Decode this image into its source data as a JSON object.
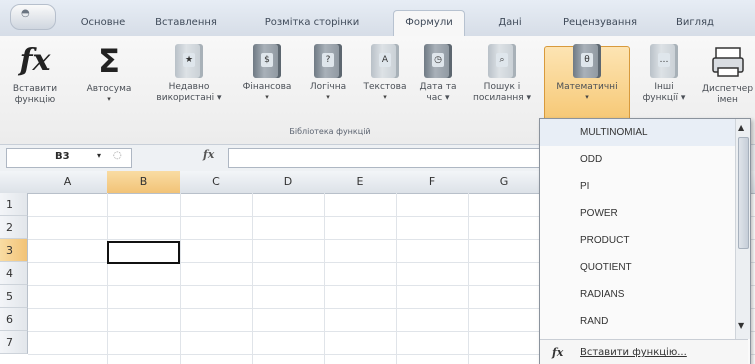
{
  "ribbon_tabs": [
    "Основне",
    "Вставлення",
    "Розмітка сторінки",
    "Формули",
    "Дані",
    "Рецензування",
    "Вигляд"
  ],
  "active_tab": "Формули",
  "ribbon": {
    "insert_function": [
      "Вставити",
      "функцію"
    ],
    "autosum": [
      "Автосума",
      "▾"
    ],
    "recent": [
      "Недавно",
      "використані ▾"
    ],
    "financial": [
      "Фінансова",
      "▾"
    ],
    "logical": [
      "Логічна",
      "▾"
    ],
    "text": [
      "Текстова",
      "▾"
    ],
    "date_time": [
      "Дата та",
      "час ▾"
    ],
    "lookup": [
      "Пошук і",
      "посилання ▾"
    ],
    "math": [
      "Математичні",
      "▾"
    ],
    "more": [
      "Інші",
      "функції ▾"
    ],
    "name_manager": [
      "Диспетчер",
      "імен"
    ],
    "group_label": "Бібліотека функцій"
  },
  "formula_bar": {
    "name_box": "B3",
    "fx": "fx",
    "value": ""
  },
  "grid": {
    "columns": [
      "A",
      "B",
      "C",
      "D",
      "E",
      "F",
      "G"
    ],
    "rows": [
      "1",
      "2",
      "3",
      "4",
      "5",
      "6",
      "7"
    ],
    "selected_column": "B",
    "selected_row": "3"
  },
  "dropdown": {
    "items": [
      "MULTINOMIAL",
      "ODD",
      "PI",
      "POWER",
      "PRODUCT",
      "QUOTIENT",
      "RADIANS",
      "RAND"
    ],
    "insert_function_label": "Вставити функцію..."
  }
}
